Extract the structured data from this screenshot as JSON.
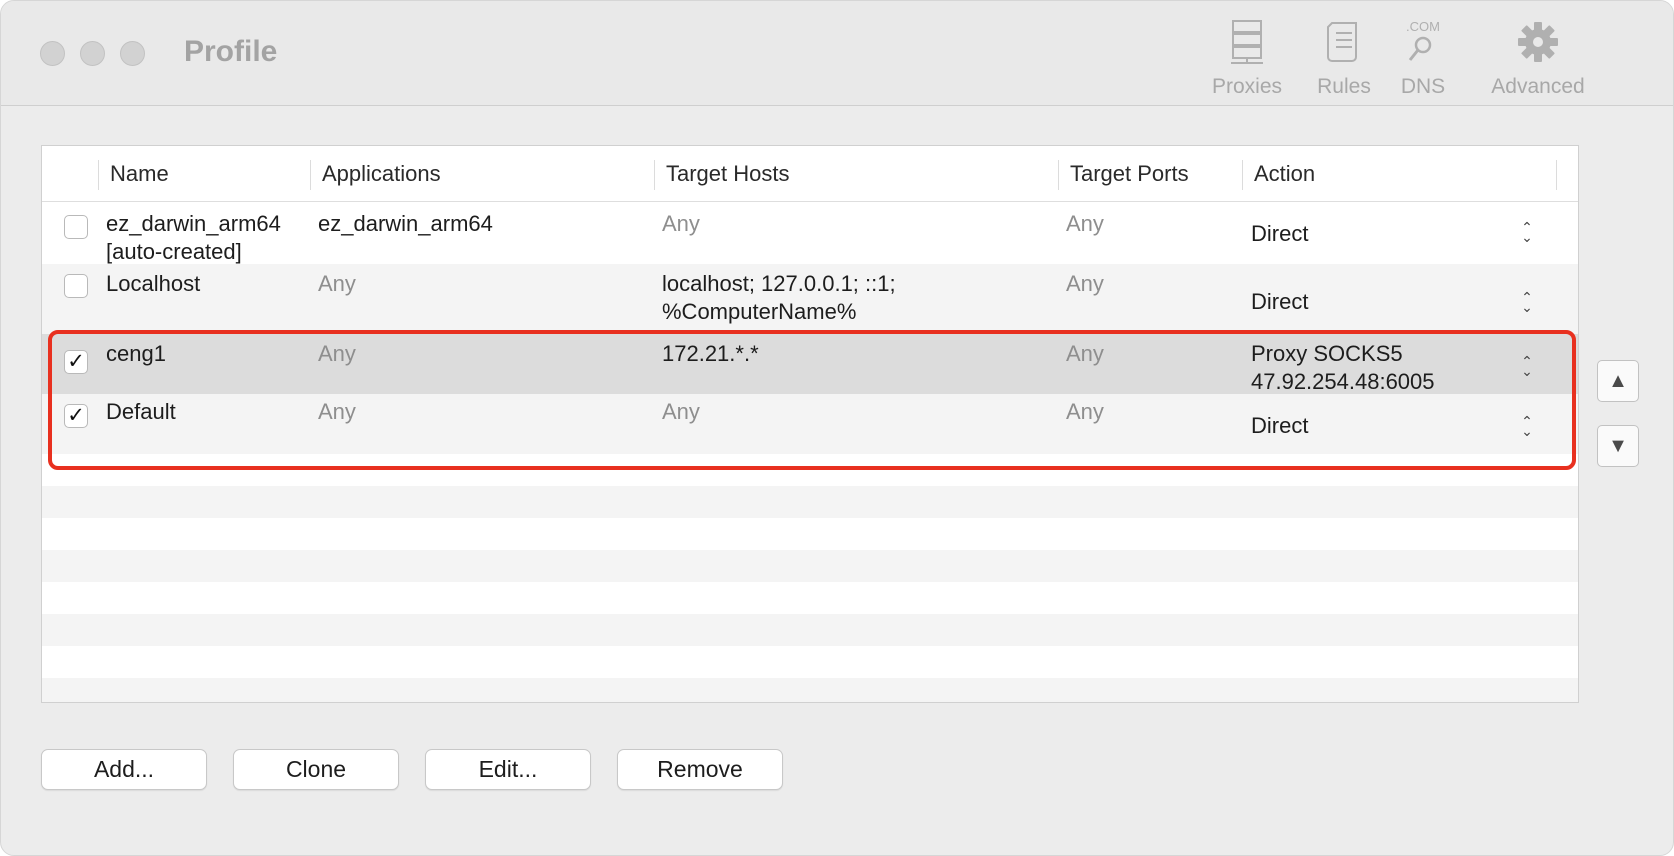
{
  "window": {
    "title": "Profile"
  },
  "toolbar": {
    "proxies": {
      "label": "Proxies",
      "icon": "server-icon"
    },
    "rules": {
      "label": "Rules",
      "icon": "document-icon"
    },
    "dns": {
      "label": "DNS",
      "icon": "dns-icon",
      "icon_text": ".COM"
    },
    "advanced": {
      "label": "Advanced",
      "icon": "gear-icon"
    }
  },
  "table": {
    "columns": [
      "Name",
      "Applications",
      "Target Hosts",
      "Target Ports",
      "Action"
    ],
    "rows": [
      {
        "checked": false,
        "name_line1": "ez_darwin_arm64",
        "name_line2": "[auto-created]",
        "applications": "ez_darwin_arm64",
        "hosts_line1": "Any",
        "hosts_line2": "",
        "ports": "Any",
        "action_line1": "Direct",
        "action_line2": ""
      },
      {
        "checked": false,
        "name_line1": "Localhost",
        "name_line2": "",
        "applications": "Any",
        "hosts_line1": "localhost; 127.0.0.1; ::1;",
        "hosts_line2": "%ComputerName%",
        "ports": "Any",
        "action_line1": "Direct",
        "action_line2": ""
      },
      {
        "checked": true,
        "name_line1": "ceng1",
        "name_line2": "",
        "applications": "Any",
        "hosts_line1": "172.21.*.*",
        "hosts_line2": "",
        "ports": "Any",
        "action_line1": "Proxy SOCKS5",
        "action_line2": "47.92.254.48:6005"
      },
      {
        "checked": true,
        "name_line1": "Default",
        "name_line2": "",
        "applications": "Any",
        "hosts_line1": "Any",
        "hosts_line2": "",
        "ports": "Any",
        "action_line1": "Direct",
        "action_line2": ""
      }
    ],
    "check_mark": "✓",
    "updown_glyph": "⌃⌄"
  },
  "side_buttons": {
    "move_up": "▲",
    "move_down": "▼"
  },
  "buttons": {
    "add": "Add...",
    "clone": "Clone",
    "edit": "Edit...",
    "remove": "Remove"
  },
  "colors": {
    "highlight": "#e8301f",
    "selected_row": "#dcdcdc"
  }
}
